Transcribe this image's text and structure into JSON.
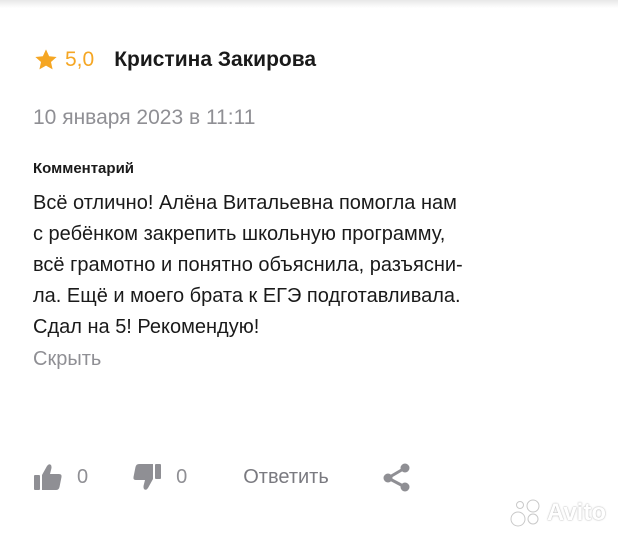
{
  "review": {
    "rating": "5,0",
    "author": "Кристина Закирова",
    "date": "10 января 2023 в 11:11",
    "comment_label": "Комментарий",
    "comment_lines": [
      "Всё отлично! Алёна Витальевна помогла нам",
      "с ребёнком закрепить школьную программу,",
      "всё грамотно и понятно объяснила, разъясни-",
      "ла. Ещё и моего брата к ЕГЭ подготавливала.",
      "Сдал на 5! Рекомендую!"
    ],
    "hide_label": "Скрыть"
  },
  "actions": {
    "likes": "0",
    "dislikes": "0",
    "reply_label": "Ответить"
  },
  "watermark": {
    "text": "Avito"
  },
  "colors": {
    "star": "#f5a623",
    "text": "#1a1a1a",
    "muted": "#8f8f94",
    "icon": "#8f8f94"
  },
  "icons": {
    "rating": "star-icon",
    "like": "thumbs-up-icon",
    "dislike": "thumbs-down-icon",
    "share": "share-icon"
  }
}
